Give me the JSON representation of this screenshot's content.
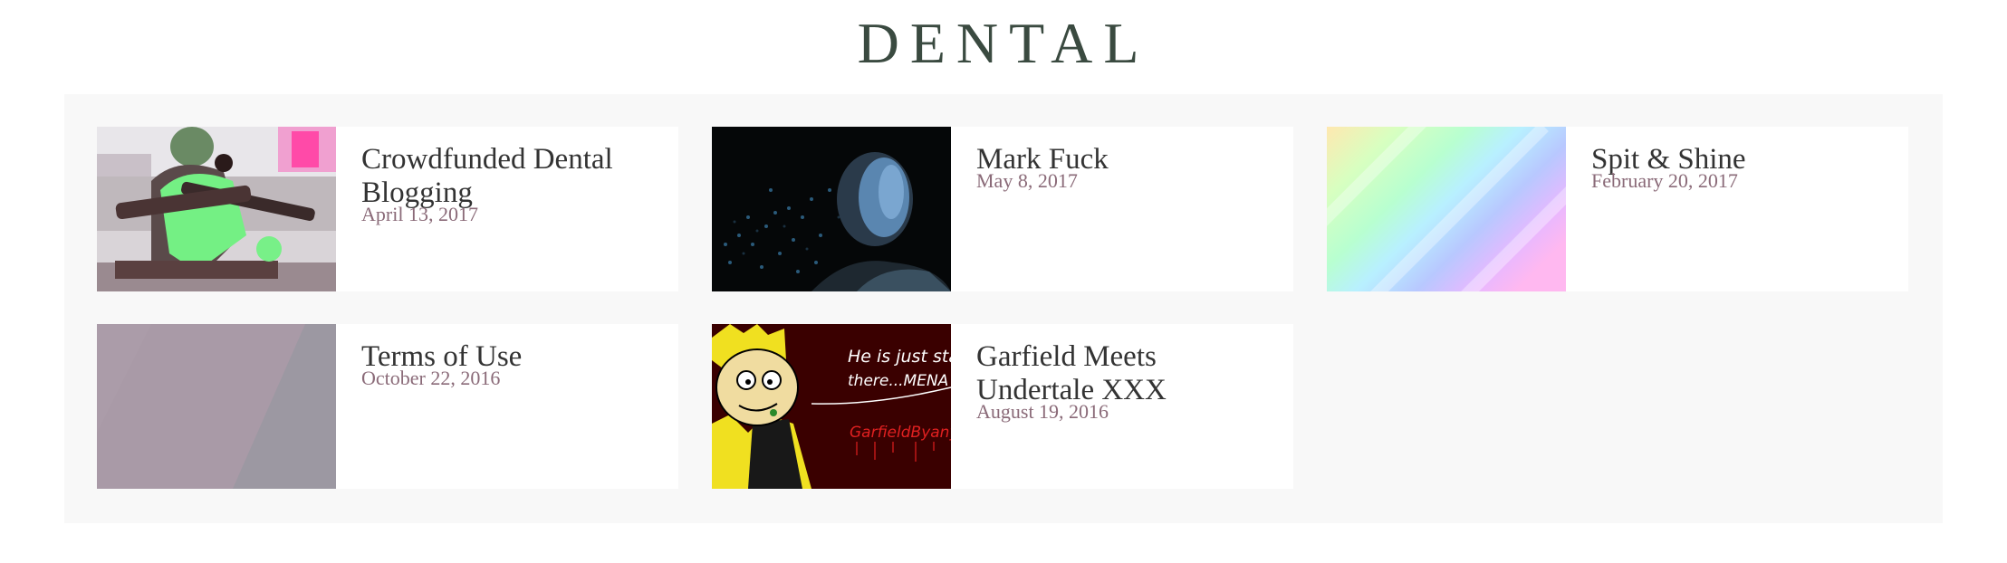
{
  "site": {
    "title": "DENTAL"
  },
  "posts": [
    {
      "title": "Crowdfunded Dental Blogging",
      "date": "April 13, 2017"
    },
    {
      "title": "Mark Fuck",
      "date": "May 8, 2017"
    },
    {
      "title": "Spit & Shine",
      "date": "February 20, 2017"
    },
    {
      "title": "Terms of Use",
      "date": "October 22, 2016"
    },
    {
      "title": "Garfield Meets Undertale XXX",
      "date": "August 19, 2016"
    }
  ],
  "thumbnail_text": {
    "garfield_caption_line1": "He is just stan",
    "garfield_caption_line2": "there...MENA",
    "garfield_signature": "GarfieldByany"
  },
  "colors": {
    "title": "#3a4a40",
    "date": "#8a6a78",
    "panel_background": "#f8f8f8"
  }
}
